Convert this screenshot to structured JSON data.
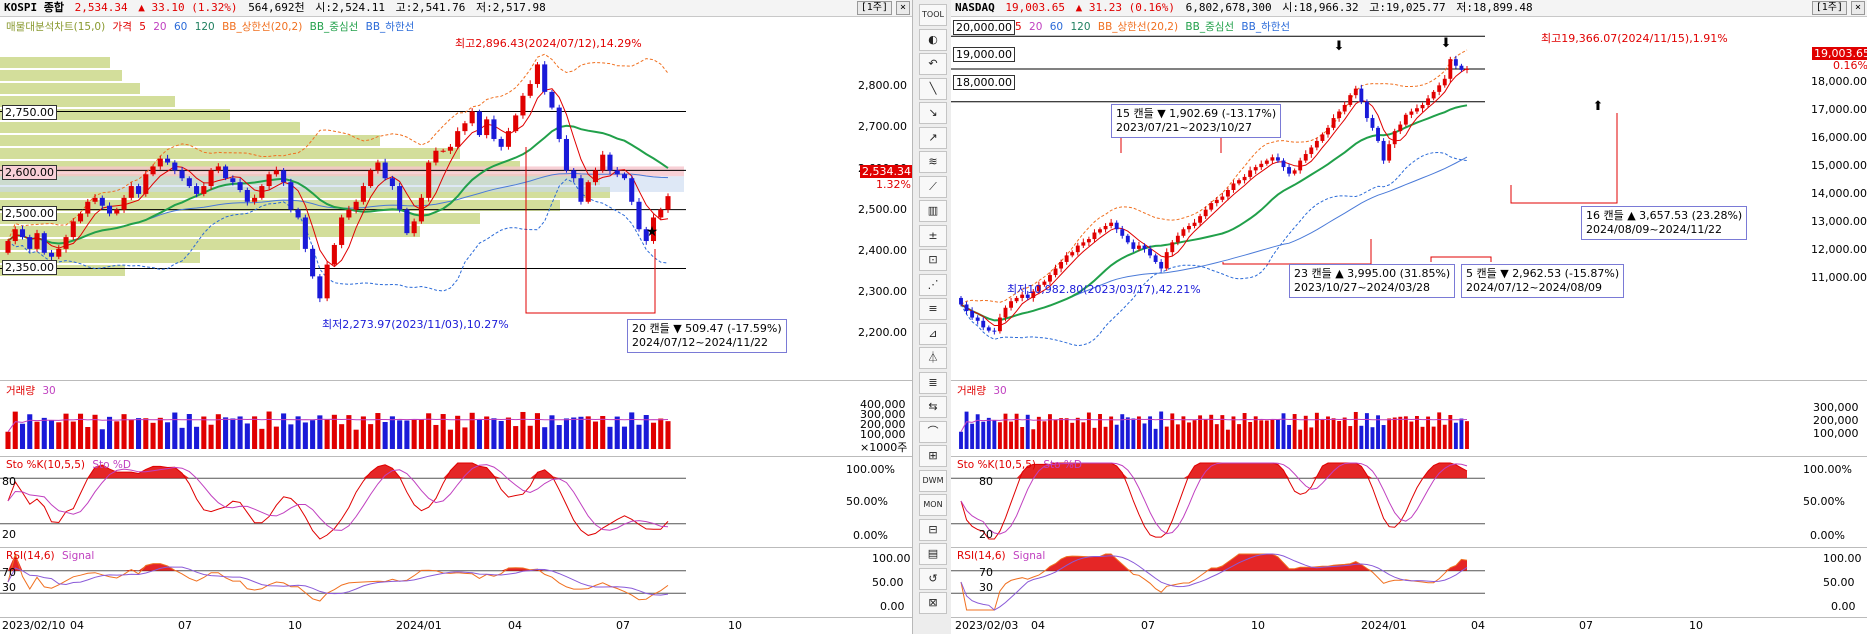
{
  "left": {
    "title": {
      "name": "KOSPI 종합",
      "price": "2,534.34",
      "change": "▲ 33.10 (1.32%)",
      "volume": "564,692천",
      "open": "시:2,524.11",
      "high": "고:2,541.76",
      "low": "저:2,517.98"
    },
    "period_button": "[1주]",
    "close_button": "×",
    "price_legend": [
      "매물대분석차트(15,0)",
      "가격",
      "5",
      "20",
      "60",
      "120",
      "BB_상한선(20,2)",
      "BB_중심선",
      "BB_하한선"
    ],
    "volume_legend": [
      "거래량",
      "30"
    ],
    "stoch_legend": [
      "Sto %K(10,5,5)",
      "Sto %D"
    ],
    "rsi_legend": [
      "RSI(14,6)",
      "Signal"
    ],
    "level_labels": [
      "2,750.00",
      "2,600.00",
      "2,500.00",
      "2,350.00"
    ],
    "price_axis": [
      "2,800.00",
      "2,700.00",
      "2,600.00",
      "2,500.00",
      "2,400.00",
      "2,300.00",
      "2,200.00"
    ],
    "price_tag": "2,534.34",
    "pct_tag": "1.32%",
    "high_note": "최고2,896.43(2024/07/12),14.29%",
    "low_note": "최저2,273.97(2023/11/03),10.27%",
    "box": {
      "line1": "20 캔들 ▼ 509.47 (-17.59%)",
      "line2": "2024/07/12~2024/11/22"
    },
    "volume_axis": [
      "400,000",
      "300,000",
      "200,000",
      "100,000",
      "×1000주"
    ],
    "stoch_axis": [
      "100.00%",
      "50.00%",
      "0.00%"
    ],
    "stoch_levels": [
      "80",
      "20"
    ],
    "rsi_axis": [
      "100.00",
      "50.00",
      "0.00"
    ],
    "rsi_levels": [
      "70",
      "30"
    ],
    "dates": [
      "2023/02/10",
      "04",
      "07",
      "10",
      "2024/01",
      "04",
      "07",
      "10"
    ]
  },
  "right": {
    "title": {
      "name": "NASDAQ",
      "price": "19,003.65",
      "change": "▲ 31.23 (0.16%)",
      "volume": "6,802,678,300",
      "open": "시:18,966.32",
      "high": "고:19,025.77",
      "low": "저:18,899.48"
    },
    "period_button": "[1주]",
    "close_button": "×",
    "price_legend": [
      "5",
      "20",
      "60",
      "120",
      "BB_상한선(20,2)",
      "BB_중심선",
      "BB_하한선"
    ],
    "volume_legend": [
      "거래량",
      "30"
    ],
    "stoch_legend": [
      "Sto %K(10,5,5)",
      "Sto %D"
    ],
    "rsi_legend": [
      "RSI(14,6)",
      "Signal"
    ],
    "level_labels": [
      "20,000.00",
      "19,000.00",
      "18,000.00"
    ],
    "price_axis": [
      "18,000.00",
      "17,000.00",
      "16,000.00",
      "15,000.00",
      "14,000.00",
      "13,000.00",
      "12,000.00",
      "11,000.00"
    ],
    "price_tag": "19,003.65",
    "pct_tag": "0.16%",
    "high_note": "최고19,366.07(2024/11/15),1.91%",
    "low_note": "최저10,982.80(2023/03/17),42.21%",
    "boxes": [
      {
        "line1": "15 캔들 ▼ 1,902.69 (-13.17%)",
        "line2": "2023/07/21~2023/10/27"
      },
      {
        "line1": "23 캔들 ▲ 3,995.00 (31.85%)",
        "line2": "2023/10/27~2024/03/28"
      },
      {
        "line1": "5 캔들 ▼ 2,962.53 (-15.87%)",
        "line2": "2024/07/12~2024/08/09"
      },
      {
        "line1": "16 캔들 ▲ 3,657.53 (23.28%)",
        "line2": "2024/08/09~2024/11/22"
      }
    ],
    "volume_axis": [
      "300,000",
      "200,000",
      "100,000"
    ],
    "stoch_axis": [
      "100.00%",
      "50.00%",
      "0.00%"
    ],
    "stoch_levels": [
      "80",
      "20"
    ],
    "rsi_axis": [
      "100.00",
      "50.00",
      "0.00"
    ],
    "rsi_levels": [
      "70",
      "30"
    ],
    "dates": [
      "2023/02/03",
      "04",
      "07",
      "10",
      "2024/01",
      "04",
      "07",
      "10"
    ]
  },
  "toolbar": [
    "TOOL",
    "◐",
    "↶",
    "╲",
    "↘",
    "↗",
    "≋",
    "⟋",
    "▥",
    "±",
    "⊡",
    "⋰",
    "≡",
    "⊿",
    "⏃",
    "≣",
    "⇆",
    "⌒",
    "⊞",
    "DWM",
    "MON",
    "⊟",
    "▤",
    "↺",
    "⊠"
  ],
  "colors": {
    "up": "#e00000",
    "down": "#1a1ad8",
    "ma5": "#e00000",
    "ma20": "#21a04a",
    "bb": "#f07020",
    "bb_low": "#2a6ad8",
    "volume_profile": "#cbd889"
  },
  "chart_data": [
    {
      "type": "candlestick",
      "title": "KOSPI 종합",
      "interval": "weekly",
      "x_range": [
        "2023/02/10",
        "2024/11/22"
      ],
      "ylim": [
        2150,
        2950
      ],
      "closes": [
        2420,
        2450,
        2430,
        2400,
        2440,
        2390,
        2380,
        2400,
        2430,
        2470,
        2490,
        2520,
        2530,
        2510,
        2490,
        2500,
        2530,
        2560,
        2540,
        2590,
        2610,
        2630,
        2620,
        2600,
        2580,
        2560,
        2540,
        2560,
        2600,
        2610,
        2580,
        2570,
        2550,
        2520,
        2530,
        2560,
        2590,
        2600,
        2570,
        2500,
        2480,
        2400,
        2330,
        2274,
        2360,
        2410,
        2480,
        2500,
        2520,
        2560,
        2600,
        2620,
        2580,
        2560,
        2500,
        2440,
        2470,
        2530,
        2620,
        2650,
        2650,
        2660,
        2700,
        2720,
        2750,
        2690,
        2730,
        2680,
        2660,
        2700,
        2740,
        2790,
        2820,
        2870,
        2800,
        2760,
        2680,
        2600,
        2580,
        2520,
        2570,
        2600,
        2640,
        2600,
        2590,
        2580,
        2520,
        2450,
        2420,
        2480,
        2500,
        2534.34
      ],
      "high": {
        "value": 2896.43,
        "date": "2024/07/12"
      },
      "low": {
        "value": 2273.97,
        "date": "2023/11/03"
      },
      "volume_profile_levels": [
        2750,
        2600,
        2500,
        2350
      ]
    },
    {
      "type": "candlestick",
      "title": "NASDAQ",
      "interval": "weekly",
      "x_range": [
        "2023/02/03",
        "2024/11/22"
      ],
      "ylim": [
        10500,
        20100
      ],
      "closes": [
        11800,
        11600,
        11400,
        11300,
        11100,
        11000,
        10983,
        11400,
        11700,
        11900,
        12000,
        12100,
        12000,
        12200,
        12400,
        12500,
        12700,
        12900,
        13100,
        13300,
        13400,
        13600,
        13700,
        13800,
        14000,
        14100,
        14200,
        14300,
        14100,
        13900,
        13700,
        13500,
        13600,
        13500,
        13300,
        13100,
        12900,
        13400,
        13700,
        13900,
        14100,
        14200,
        14300,
        14500,
        14700,
        14900,
        15000,
        15100,
        15300,
        15500,
        15600,
        15700,
        15900,
        16000,
        16100,
        16200,
        16300,
        16200,
        16000,
        15800,
        15900,
        16200,
        16400,
        16600,
        16800,
        17000,
        17200,
        17500,
        17700,
        17900,
        18200,
        18400,
        18000,
        17500,
        17200,
        16800,
        16200,
        16700,
        17100,
        17300,
        17600,
        17700,
        17800,
        17900,
        18100,
        18300,
        18500,
        18700,
        19300,
        19100,
        18972,
        19003.65
      ],
      "high": {
        "value": 19366.07,
        "date": "2024/11/15"
      },
      "low": {
        "value": 10982.8,
        "date": "2023/03/17"
      },
      "levels": [
        20000,
        19000,
        18000
      ]
    }
  ]
}
